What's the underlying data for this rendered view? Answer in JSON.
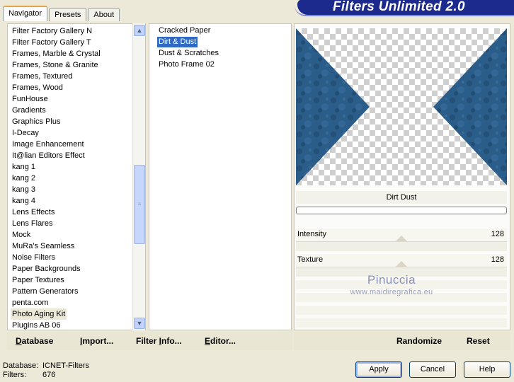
{
  "tabs": [
    {
      "label": "Navigator",
      "active": true
    },
    {
      "label": "Presets",
      "active": false
    },
    {
      "label": "About",
      "active": false
    }
  ],
  "app_title": "Filters Unlimited 2.0",
  "categories": [
    "Filter Factory Gallery N",
    "Filter Factory Gallery T",
    "Frames, Marble & Crystal",
    "Frames, Stone & Granite",
    "Frames, Textured",
    "Frames, Wood",
    "FunHouse",
    "Gradients",
    "Graphics Plus",
    "I-Decay",
    "Image Enhancement",
    "It@lian Editors Effect",
    "kang 1",
    "kang 2",
    "kang 3",
    "kang 4",
    "Lens Effects",
    "Lens Flares",
    "Mock",
    "MuRa's Seamless",
    "Noise Filters",
    "Paper Backgrounds",
    "Paper Textures",
    "Pattern Generators",
    "penta.com",
    "Photo Aging Kit",
    "Plugins AB 06"
  ],
  "selected_category": "Photo Aging Kit",
  "filters": [
    "Cracked Paper",
    "Dirt & Dust",
    "Dust & Scratches",
    "Photo Frame 02"
  ],
  "selected_filter": "Dirt & Dust",
  "filter_name_display": "Dirt  Dust",
  "sliders": [
    {
      "label": "Intensity",
      "value": "128"
    },
    {
      "label": "Texture",
      "value": "128"
    }
  ],
  "watermark": {
    "line1": "Pinuccia",
    "line2": "www.maidiregrafica.eu"
  },
  "left_toolbar": {
    "database": {
      "u": "D",
      "rest": "atabase"
    },
    "import": {
      "u": "I",
      "rest": "mport..."
    },
    "filter_info": {
      "pre": "Filter ",
      "u": "I",
      "rest": "nfo..."
    },
    "editor": {
      "u": "E",
      "rest": "ditor..."
    }
  },
  "right_toolbar": {
    "randomize": "Randomize",
    "reset": "Reset"
  },
  "footer": {
    "database_label": "Database:",
    "database_value": "ICNET-Filters",
    "filters_label": "Filters:",
    "filters_value": "676"
  },
  "buttons": {
    "apply": "Apply",
    "cancel": "Cancel",
    "help": "Help"
  },
  "scroll_icons": {
    "up": "chevron-up-icon",
    "down": "chevron-down-icon",
    "thumb": "grip-icon"
  },
  "colors": {
    "accent": "#316ac5",
    "banner": "#1c2a8d",
    "texture": "#2b5d8a"
  }
}
